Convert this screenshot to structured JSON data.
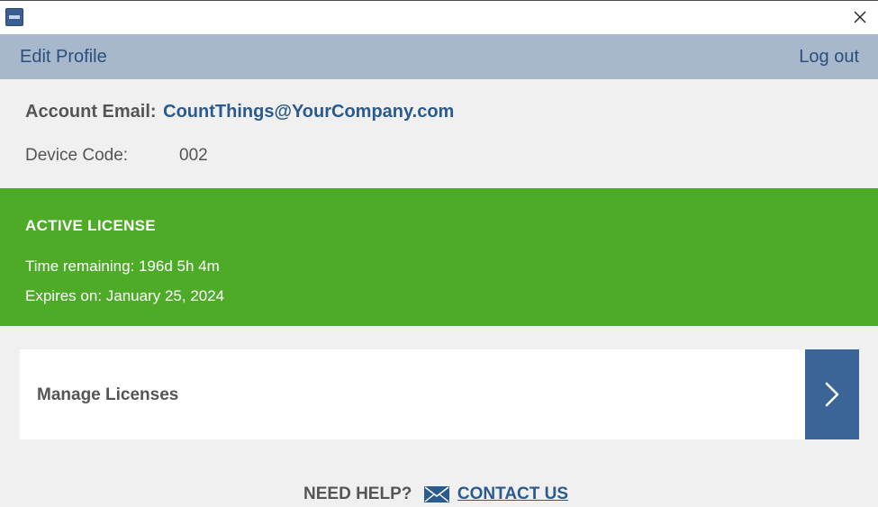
{
  "titlebar": {
    "app_icon": "app-icon",
    "close_icon": "close-icon"
  },
  "menubar": {
    "edit_profile": "Edit Profile",
    "log_out": "Log out"
  },
  "account": {
    "email_label": "Account Email:",
    "email_value": "CountThings@YourCompany.com",
    "device_label": "Device Code:",
    "device_value": "002"
  },
  "license": {
    "heading": "ACTIVE LICENSE",
    "time_remaining": "Time remaining: 196d 5h 4m",
    "expires_on": "Expires on: January 25, 2024",
    "status_color": "#4dab28"
  },
  "manage": {
    "label": "Manage Licenses",
    "arrow_icon": "chevron-right-icon",
    "accent_color": "#3a6596"
  },
  "help": {
    "need_help": "NEED HELP?",
    "mail_icon": "envelope-icon",
    "contact_us": "CONTACT US"
  }
}
